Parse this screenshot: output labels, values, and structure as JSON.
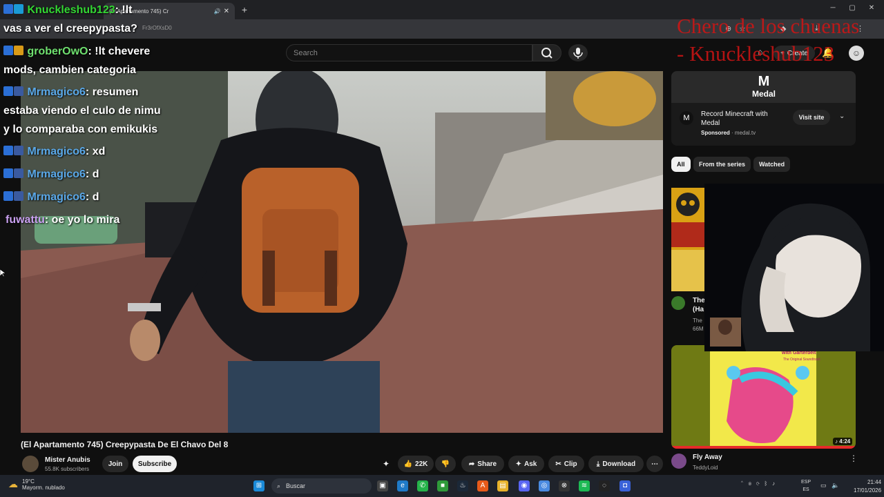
{
  "browser": {
    "tab_title": "(El Apartamento 745) Cr",
    "url": "Fr3rOfXsD0"
  },
  "youtube": {
    "search_placeholder": "Search",
    "create_label": "Create",
    "video": {
      "title": "(El Apartamento 745) Creepypasta De El Chavo Del 8",
      "channel": "Mister Anubis",
      "subscribers": "55.8K subscribers",
      "join": "Join",
      "subscribe": "Subscribe",
      "likes": "22K",
      "share": "Share",
      "ask": "Ask",
      "clip": "Clip",
      "download": "Download"
    },
    "ad": {
      "brand": "Medal",
      "title": "Record Minecraft with Medal",
      "sponsored": "Sponsored",
      "domain": "medal.tv",
      "visit": "Visit site"
    },
    "chips": [
      "All",
      "From the series",
      "Watched"
    ],
    "related": [
      {
        "title_line1": "The",
        "title_line2": "(Ha",
        "channel_line1": "The",
        "channel_line2": "66M"
      },
      {
        "title": "Fly Away",
        "channel": "TeddyLoid",
        "duration": "4:24",
        "thumb_text_1": "with Garterbelt",
        "thumb_text_2": "The Original Soundtrack"
      }
    ]
  },
  "stream_overlay": {
    "title_line1": "Chero de los chuenas",
    "title_line2": "- Knuckleshub123",
    "chat": [
      {
        "user": "Knuckleshub123",
        "user_color": "#33d633",
        "msg": ": !lt"
      },
      {
        "user": "",
        "user_color": "#ffffff",
        "msg": "vas a ver el creepypasta?"
      },
      {
        "user": "groberOwO",
        "user_color": "#6fe06f",
        "msg": ": !lt chevere"
      },
      {
        "user": "",
        "user_color": "#ffffff",
        "msg": "mods, cambien categoria"
      },
      {
        "user": "Mrmagico6",
        "user_color": "#5aa8e8",
        "msg": ": resumen"
      },
      {
        "user": "",
        "user_color": "#ffffff",
        "msg": "estaba viendo el culo de nimu"
      },
      {
        "user": "",
        "user_color": "#ffffff",
        "msg": "y lo comparaba con emikukis"
      },
      {
        "user": "Mrmagico6",
        "user_color": "#5aa8e8",
        "msg": ": xd"
      },
      {
        "user": "Mrmagico6",
        "user_color": "#5aa8e8",
        "msg": ": d"
      },
      {
        "user": "Mrmagico6",
        "user_color": "#5aa8e8",
        "msg": ": d"
      },
      {
        "user": "fuwattu",
        "user_color": "#c9a0f0",
        "msg": ": oe yo lo mira"
      }
    ]
  },
  "taskbar": {
    "temp": "19°C",
    "weather": "Mayorm. nublado",
    "search_placeholder": "Buscar",
    "lang_1": "ESP",
    "lang_2": "ES",
    "time": "21:44",
    "date": "17/01/2026"
  },
  "colors": {
    "accent": "#f1f1f1",
    "yt_bg": "#0f0f0f",
    "overlay_red": "#d21414"
  }
}
